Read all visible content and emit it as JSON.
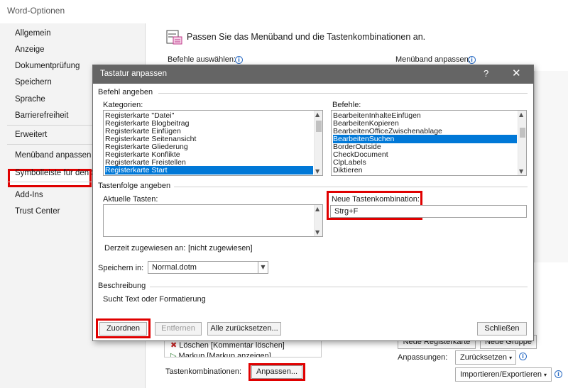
{
  "outer_window": {
    "title": "Word-Optionen",
    "nav": {
      "items": [
        {
          "label": "Allgemein"
        },
        {
          "label": "Anzeige"
        },
        {
          "label": "Dokumentprüfung"
        },
        {
          "label": "Speichern"
        },
        {
          "label": "Sprache"
        },
        {
          "label": "Barrierefreiheit"
        },
        {
          "label": "Erweitert"
        },
        {
          "label": "Menüband anpassen",
          "selected": true
        },
        {
          "label": "Symbolleiste für den Sc"
        },
        {
          "label": "Add-Ins"
        },
        {
          "label": "Trust Center"
        }
      ]
    },
    "heading": "Passen Sie das Menüband und die Tastenkombinationen an.",
    "label_choose_commands": "Befehle auswählen:",
    "label_customize_ribbon": "Menüband anpassen:",
    "bottom_list": [
      "Löschen [Kommentar löschen]",
      "Markup [Markup anzeigen]"
    ],
    "new_tab_label": "Neue Registerkarte",
    "new_group_label": "Neue Gruppe",
    "customizations_label": "Anpassungen:",
    "reset_label": "Zurücksetzen",
    "import_export_label": "Importieren/Exportieren",
    "shortcuts_label": "Tastenkombinationen:",
    "customize_button_label": "Anpassen..."
  },
  "dialog": {
    "title": "Tastatur anpassen",
    "help_label": "?",
    "close_icon": "close-icon",
    "section_command": "Befehl angeben",
    "label_categories": "Kategorien:",
    "categories": [
      "Registerkarte \"Datei\"",
      "Registerkarte Blogbeitrag",
      "Registerkarte Einfügen",
      "Registerkarte Seitenansicht",
      "Registerkarte Gliederung",
      "Registerkarte Konflikte",
      "Registerkarte Freistellen",
      "Registerkarte Start"
    ],
    "selected_category_index": 7,
    "label_commands": "Befehle:",
    "commands": [
      "BearbeitenInhalteEinfügen",
      "BearbeitenKopieren",
      "BearbeitenOfficeZwischenablage",
      "BearbeitenSuchen",
      "BorderOutside",
      "CheckDocument",
      "ClpLabels",
      "Diktieren"
    ],
    "selected_command_index": 3,
    "section_keys": "Tastenfolge angeben",
    "label_current_keys": "Aktuelle Tasten:",
    "label_new_shortcut": "Neue Tastenkombination:",
    "new_shortcut_value": "Strg+F",
    "currently_assigned_label": "Derzeit zugewiesen an:",
    "currently_assigned_value": "[nicht zugewiesen]",
    "save_in_label": "Speichern in:",
    "save_in_value": "Normal.dotm",
    "section_description": "Beschreibung",
    "description_text": "Sucht Text oder Formatierung",
    "buttons": {
      "assign": "Zuordnen",
      "remove": "Entfernen",
      "reset_all": "Alle zurücksetzen...",
      "close": "Schließen"
    },
    "accent_color": "#0078d7",
    "highlight_color": "#e00000"
  }
}
